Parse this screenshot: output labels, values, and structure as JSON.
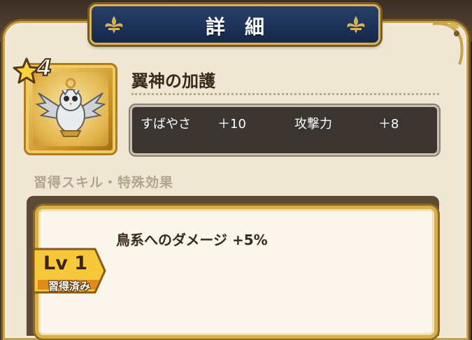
{
  "header": {
    "title": "詳細"
  },
  "item": {
    "name": "翼神の加護",
    "rarity": 4,
    "icon": "winged-owl-emblem-icon"
  },
  "stats": [
    {
      "label": "すばやさ",
      "value": "＋10"
    },
    {
      "label": "攻撃力",
      "value": "＋8"
    }
  ],
  "section": {
    "title": "習得スキル・特殊効果"
  },
  "skill": {
    "text": "鳥系へのダメージ +5%",
    "level": "Lv 1",
    "status": "習得済み"
  },
  "colors": {
    "title_plate": "#1c3159",
    "gold_border": "#d8b35a",
    "panel_bg": "#efe6d3",
    "stats_bg": "#3a3530"
  }
}
